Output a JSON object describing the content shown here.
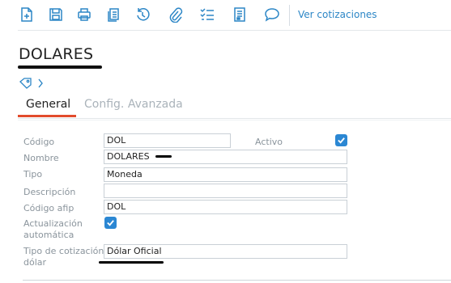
{
  "toolbar": {
    "icons": [
      "new-document-icon",
      "save-icon",
      "print-icon",
      "copy-icon",
      "history-icon",
      "attach-icon",
      "checklist-icon",
      "document-icon",
      "comment-icon"
    ],
    "link_label": "Ver cotizaciones",
    "accent": "#2c86c6"
  },
  "record": {
    "title": "DOLARES"
  },
  "tabs": {
    "general": "General",
    "config": "Config. Avanzada",
    "active_color": "#e24b2c"
  },
  "form": {
    "codigo": {
      "label": "Código",
      "value": "DOL"
    },
    "activo": {
      "label": "Activo",
      "checked": true
    },
    "nombre": {
      "label": "Nombre",
      "value": "DOLARES"
    },
    "tipo": {
      "label": "Tipo",
      "value": "Moneda"
    },
    "descripcion": {
      "label": "Descripción",
      "value": ""
    },
    "codigo_afip": {
      "label": "Código afip",
      "value": "DOL"
    },
    "actualizacion": {
      "label_line1": "Actualización",
      "label_line2": "automática",
      "checked": true
    },
    "tipo_cotizacion": {
      "label_line1": "Tipo de cotización",
      "label_line2": "dólar",
      "value": "Dólar Oficial"
    }
  },
  "checkbox_color": "#2b87d3"
}
